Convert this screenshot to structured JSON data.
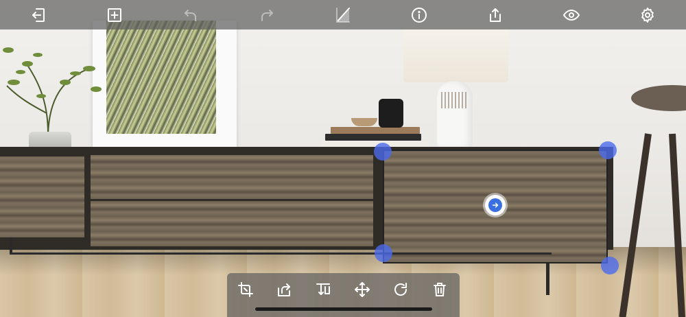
{
  "top_toolbar": {
    "buttons": [
      {
        "name": "exit-icon",
        "enabled": true
      },
      {
        "name": "add-icon",
        "enabled": true
      },
      {
        "name": "undo-icon",
        "enabled": false
      },
      {
        "name": "redo-icon",
        "enabled": false
      },
      {
        "name": "compare-icon",
        "enabled": true
      },
      {
        "name": "info-icon",
        "enabled": true
      },
      {
        "name": "share-icon",
        "enabled": true
      },
      {
        "name": "preview-icon",
        "enabled": true
      },
      {
        "name": "settings-icon",
        "enabled": true
      }
    ]
  },
  "bottom_toolbar": {
    "buttons": [
      {
        "name": "crop-icon"
      },
      {
        "name": "replace-image-icon"
      },
      {
        "name": "flip-icon"
      },
      {
        "name": "move-icon"
      },
      {
        "name": "rotate-icon"
      },
      {
        "name": "delete-icon"
      }
    ]
  },
  "selection": {
    "handle_icons": [
      "resize-handle",
      "resize-handle",
      "resize-handle",
      "resize-handle"
    ],
    "center_icon": "arrow-right-icon",
    "accent_color": "#3a6fe0"
  },
  "colors": {
    "toolbar_bg": "rgba(95,95,95,0.72)",
    "handle": "#4c6ceb"
  }
}
